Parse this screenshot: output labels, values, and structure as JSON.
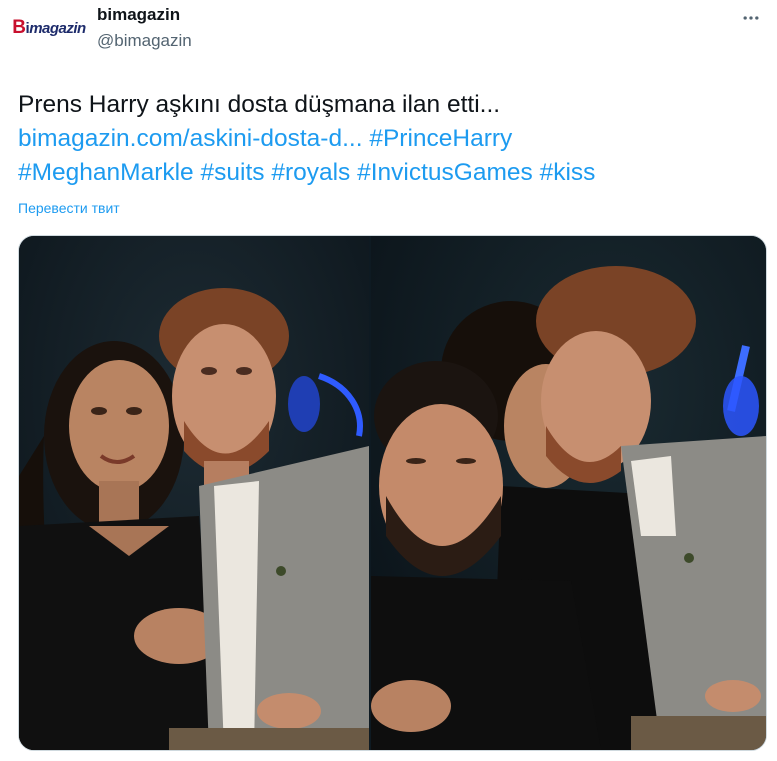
{
  "author": {
    "display_name": "bimagazin",
    "handle": "@bimagazin",
    "avatar_logo": "Bimagazin",
    "avatar_logo_parts": {
      "b": "B",
      "i": "i",
      "rest": "magazin"
    }
  },
  "more_icon": "more-horizontal-icon",
  "tweet": {
    "text_line1": "Prens Harry aşkını dosta düşmana ilan etti...",
    "link_url_text": "bimagazin.com/askini-dosta-d...",
    "hashtag_1": "#PrinceHarry",
    "hashtag_2": "#MeghanMarkle",
    "hashtag_3": "#suits",
    "hashtag_4": "#royals",
    "hashtag_5": "#InvictusGames",
    "hashtag_6": "#kiss"
  },
  "translate_label": "Перевести твит",
  "colors": {
    "link": "#1d9bf0",
    "text": "#0f1419",
    "secondary": "#536471",
    "border": "#cfd9de",
    "photo_bg": "#0e1a22"
  },
  "media": {
    "photos": [
      {
        "name": "left-photo",
        "alt": ""
      },
      {
        "name": "right-photo",
        "alt": ""
      }
    ]
  }
}
